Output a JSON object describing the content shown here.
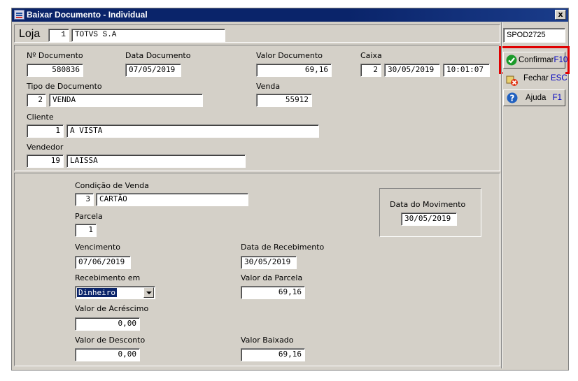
{
  "window": {
    "title": "Baixar Documento - Individual",
    "close_label": "x"
  },
  "header": {
    "loja_label": "Loja",
    "loja_code": "1",
    "loja_name": "TOTVS S.A",
    "station": "SPOD2725"
  },
  "document": {
    "num_doc_label": "Nº Documento",
    "num_doc_value": "580836",
    "data_doc_label": "Data Documento",
    "data_doc_value": "07/05/2019",
    "valor_doc_label": "Valor Documento",
    "valor_doc_value": "69,16",
    "caixa_label": "Caixa",
    "caixa_code": "2",
    "caixa_date": "30/05/2019",
    "caixa_time": "10:01:07",
    "tipo_doc_label": "Tipo de Documento",
    "tipo_doc_code": "2",
    "tipo_doc_name": "VENDA",
    "venda_label": "Venda",
    "venda_value": "55912",
    "cliente_label": "Cliente",
    "cliente_code": "1",
    "cliente_name": "A VISTA",
    "vendedor_label": "Vendedor",
    "vendedor_code": "19",
    "vendedor_name": "LAISSA"
  },
  "payment": {
    "cond_venda_label": "Condição de Venda",
    "cond_venda_code": "3",
    "cond_venda_name": "CARTÃO",
    "parcela_label": "Parcela",
    "parcela_value": "1",
    "vencimento_label": "Vencimento",
    "vencimento_value": "07/06/2019",
    "data_receb_label": "Data de Recebimento",
    "data_receb_value": "30/05/2019",
    "receb_em_label": "Recebimento em",
    "receb_em_value": "Dinheiro",
    "valor_parcela_label": "Valor da Parcela",
    "valor_parcela_value": "69,16",
    "valor_acresc_label": "Valor de Acréscimo",
    "valor_acresc_value": "0,00",
    "valor_desc_label": "Valor de Desconto",
    "valor_desc_value": "0,00",
    "valor_baixado_label": "Valor Baixado",
    "valor_baixado_value": "69,16",
    "data_mov_label": "Data do Movimento",
    "data_mov_value": "30/05/2019"
  },
  "buttons": {
    "confirmar_label": "Confirmar",
    "confirmar_key": "F10",
    "fechar_label": "Fechar",
    "fechar_key": "ESC",
    "ajuda_label": "Ajuda",
    "ajuda_key": "F1"
  },
  "colors": {
    "title_bar": "#0a246a",
    "window_bg": "#d4d0c8",
    "highlight_border": "#e00000",
    "hotkey": "#0000c0"
  }
}
